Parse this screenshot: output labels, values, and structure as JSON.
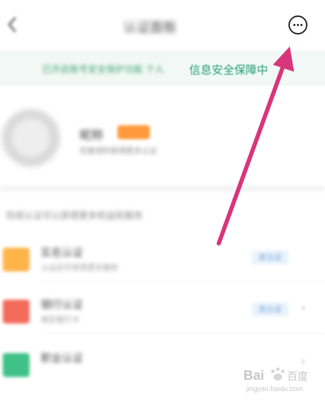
{
  "header": {
    "title": "认证面板",
    "back_icon": "chevron-left-icon",
    "more_icon": "more-horizontal-circle-icon"
  },
  "banner": {
    "blurred_text": "已开启账号安全保护功能 个人",
    "clear_text": "信息安全保障中",
    "color": "#2aa178"
  },
  "profile": {
    "name": "昵称",
    "badge": "",
    "subtitle": "完善资料获得更多认证"
  },
  "section": {
    "hint": "完成认证可以获得更多权益和服务"
  },
  "rows": [
    {
      "title": "实名认证",
      "subtitle": "认证后可享受更多服务",
      "button": "去认证",
      "icon_color": "#ffb44a"
    },
    {
      "title": "银行认证",
      "subtitle": "绑定银行卡",
      "button": "去认证",
      "icon_color": "#f26b5b"
    },
    {
      "title": "职业认证",
      "subtitle": "",
      "button": "",
      "icon_color": "#3fc187"
    }
  ],
  "annotation": {
    "arrow_color": "#d8357a"
  },
  "watermark": {
    "brand": "Bai 百度",
    "sub": "jingyan.baidu.com"
  }
}
